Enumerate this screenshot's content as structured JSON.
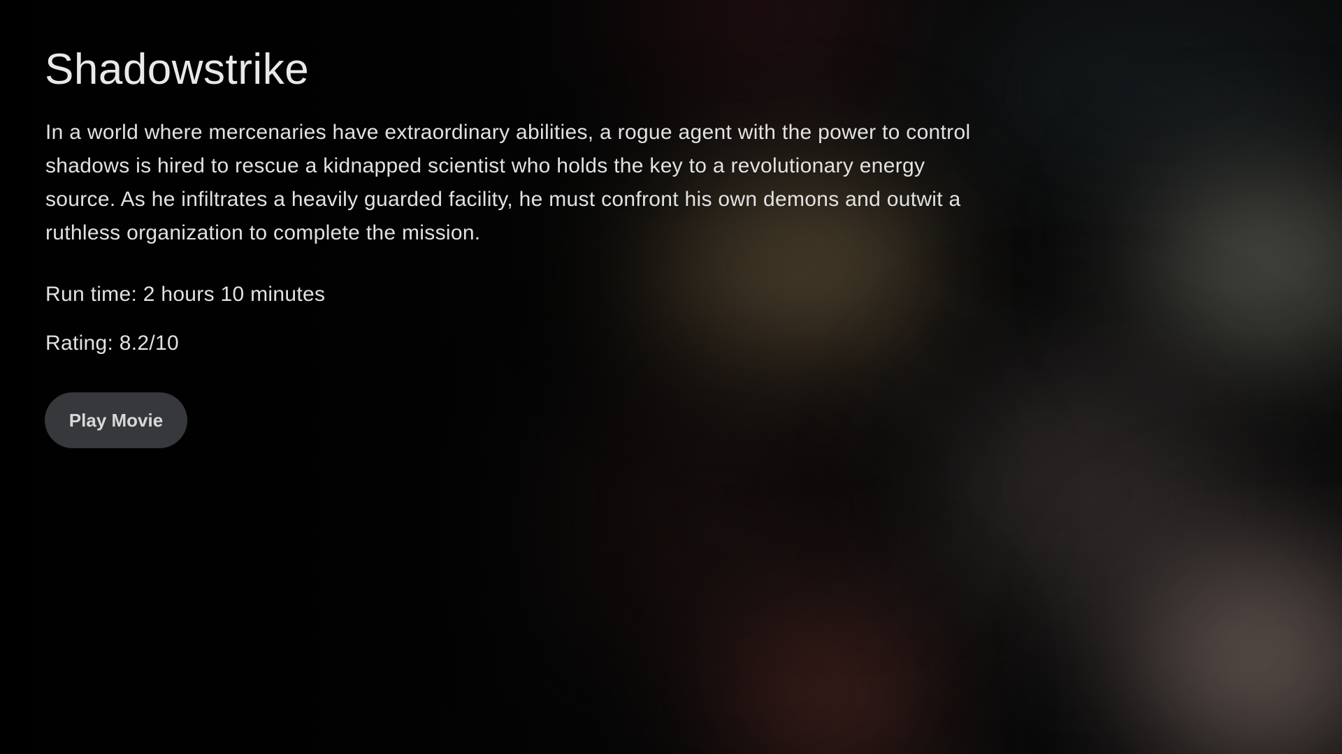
{
  "movie": {
    "title": "Shadowstrike",
    "description": "In a world where mercenaries have extraordinary abilities, a rogue agent with the power to control shadows is hired to rescue a kidnapped scientist who holds the key to a revolutionary energy source. As he infiltrates a heavily guarded facility, he must confront his own demons and outwit a ruthless organization to complete the mission.",
    "run_time": "Run time: 2 hours 10 minutes",
    "rating": "Rating: 8.2/10"
  },
  "actions": {
    "play_label": "Play Movie"
  },
  "colors": {
    "background": "#0b0b0b",
    "text": "#e6e6e6",
    "button_bg": "#36383c",
    "button_text": "#d8d8d8"
  }
}
